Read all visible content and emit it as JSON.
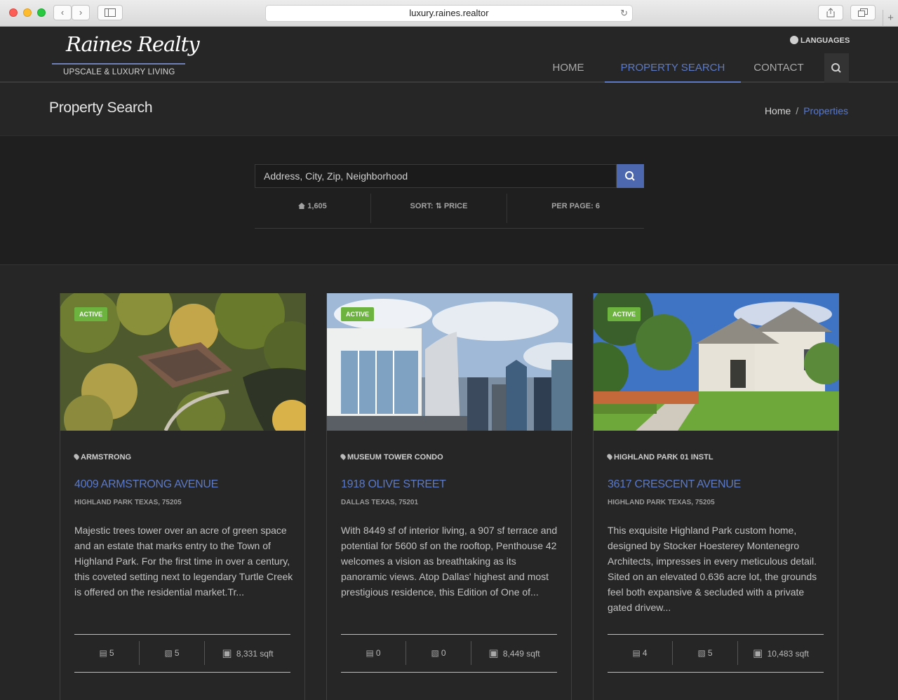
{
  "browser": {
    "url": "luxury.raines.realtor"
  },
  "header": {
    "logo_script": "Raines Realty",
    "logo_sub": "UPSCALE & LUXURY LIVING",
    "languages": "LANGUAGES",
    "nav": [
      {
        "label": "HOME"
      },
      {
        "label": "PROPERTY SEARCH"
      },
      {
        "label": "CONTACT"
      }
    ]
  },
  "title_bar": {
    "title": "Property Search",
    "breadcrumb": {
      "home": "Home",
      "separator": "/",
      "current": "Properties"
    }
  },
  "search": {
    "placeholder": "Address, City, Zip, Neighborhood",
    "count": "1,605",
    "sort_label": "SORT:",
    "sort_value": "PRICE",
    "per_page": "PER PAGE: 6"
  },
  "listings": [
    {
      "status": "ACTIVE",
      "neighborhood": "ARMSTRONG",
      "address": "4009 ARMSTRONG AVENUE",
      "city": "HIGHLAND PARK TEXAS, 75205",
      "description": "Majestic trees tower over an acre of green space and an estate that marks entry to the Town of Highland Park. For the first time in over a century, this coveted setting next to legendary Turtle Creek is offered on the residential market.Tr...",
      "beds": "5",
      "baths": "5",
      "sqft": "8,331 sqft"
    },
    {
      "status": "ACTIVE",
      "neighborhood": "MUSEUM TOWER CONDO",
      "address": "1918 OLIVE STREET",
      "city": "DALLAS TEXAS, 75201",
      "description": "With 8449 sf of interior living, a 907 sf terrace and potential for 5600 sf on the rooftop, Penthouse 42 welcomes a vision as breathtaking as its panoramic views. Atop Dallas' highest and most prestigious residence, this Edition of One of...",
      "beds": "0",
      "baths": "0",
      "sqft": "8,449 sqft"
    },
    {
      "status": "ACTIVE",
      "neighborhood": "HIGHLAND PARK 01 INSTL",
      "address": "3617 CRESCENT AVENUE",
      "city": "HIGHLAND PARK TEXAS, 75205",
      "description": "This exquisite Highland Park custom home, designed by Stocker Hoesterey Montenegro Architects, impresses in every meticulous detail. Sited on an elevated 0.636 acre lot, the grounds feel both expansive & secluded with a private gated drivew...",
      "beds": "4",
      "baths": "5",
      "sqft": "10,483 sqft"
    }
  ],
  "colors": {
    "accent": "#5b79c7",
    "badge": "#6cb33f",
    "search_button": "#4e68b0"
  }
}
